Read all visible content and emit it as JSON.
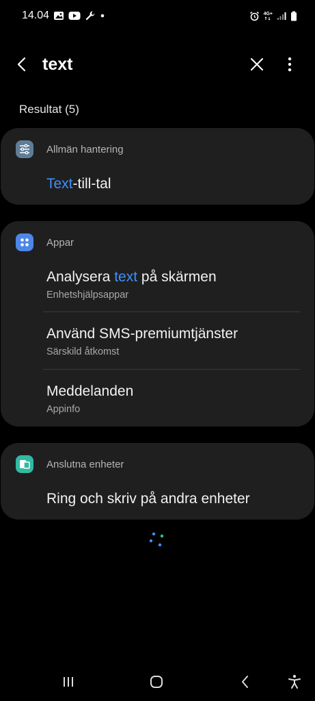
{
  "status_bar": {
    "time": "14.04",
    "network_label": "4G+",
    "icons_left": [
      "gallery-icon",
      "youtube-icon",
      "wrench-icon",
      "dot-icon"
    ],
    "icons_right": [
      "alarm-icon",
      "signal-icon",
      "battery-icon"
    ]
  },
  "search": {
    "query": "text",
    "back_icon": "back-arrow-icon",
    "clear_icon": "close-icon",
    "more_icon": "more-vert-icon"
  },
  "results": {
    "count_label": "Resultat (5)",
    "groups": [
      {
        "category": "Allmän hantering",
        "icon": "sliders-icon",
        "icon_color": "#5f7d96",
        "items": [
          {
            "title_pre": "",
            "title_hl": "Text",
            "title_post": "-till-tal",
            "subtitle": ""
          }
        ]
      },
      {
        "category": "Appar",
        "icon": "apps-grid-icon",
        "icon_color": "#4d86e6",
        "items": [
          {
            "title_pre": "Analysera ",
            "title_hl": "text",
            "title_post": " på skärmen",
            "subtitle": "Enhetshjälpsappar"
          },
          {
            "title_pre": "Använd SMS-premiumtjänster",
            "title_hl": "",
            "title_post": "",
            "subtitle": "Särskild åtkomst"
          },
          {
            "title_pre": "Meddelanden",
            "title_hl": "",
            "title_post": "",
            "subtitle": "Appinfo"
          }
        ]
      },
      {
        "category": "Anslutna enheter",
        "icon": "connected-devices-icon",
        "icon_color": "#33b8a3",
        "items": [
          {
            "title_pre": "Ring och skriv på andra enheter",
            "title_hl": "",
            "title_post": "",
            "subtitle": ""
          }
        ]
      }
    ]
  },
  "colors": {
    "background": "#000000",
    "card": "#1f1f1f",
    "highlight": "#3e91ff",
    "secondary_text": "#a9a9a9"
  },
  "nav_bar": {
    "recents_icon": "recents-icon",
    "home_icon": "home-icon",
    "back_icon": "nav-back-icon",
    "accessibility_icon": "accessibility-icon"
  }
}
